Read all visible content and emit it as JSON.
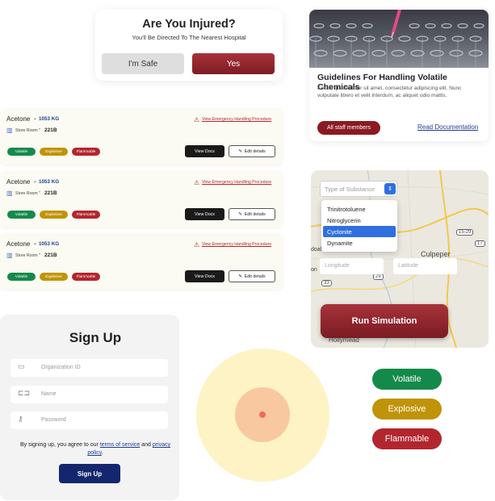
{
  "injury_dialog": {
    "title": "Are You Injured?",
    "subtitle": "You'll Be Directed To The Nearest Hospital",
    "safe_label": "I'm Safe",
    "yes_label": "Yes"
  },
  "guidelines": {
    "title": "Guidelines For Handling Volatile Chemicals",
    "body": "Korem ipsum dolor sit amet, consectetur adipiscing elit. Nunc vulputate libero et velit interdum, ac aliquet odio mattis.",
    "audience": "All staff members",
    "link": "Read Documentation"
  },
  "chemicals": [
    {
      "name": "Acetone",
      "sep": "•",
      "qty": "1053 KG",
      "store": "Store Room",
      "store_sep": "•",
      "room": "221B",
      "procedure": "View Emergency Handling Procedure",
      "tags": [
        "Volatile",
        "Explosive",
        "Flammable"
      ],
      "view": "View Docs",
      "edit": "Edit details"
    },
    {
      "name": "Acetone",
      "sep": "•",
      "qty": "1053 KG",
      "store": "Store Room",
      "store_sep": "•",
      "room": "221B",
      "procedure": "View Emergency Handling Procedure",
      "tags": [
        "Volatile",
        "Explosive",
        "Flammable"
      ],
      "view": "View Docs",
      "edit": "Edit details"
    },
    {
      "name": "Acetone",
      "sep": "•",
      "qty": "1053 KG",
      "store": "Store Room",
      "store_sep": "•",
      "room": "221B",
      "procedure": "View Emergency Handling Procedure",
      "tags": [
        "Volatile",
        "Explosive",
        "Flammable"
      ],
      "view": "View Docs",
      "edit": "Edit details"
    }
  ],
  "simulation": {
    "select_placeholder": "Type of Substance",
    "options": [
      "Trinitrotoluene",
      "Nitroglycerin",
      "Cyclonite",
      "Dynamite"
    ],
    "selected": "Cyclonite",
    "longitude_placeholder": "Longitude",
    "latitude_placeholder": "Latitude",
    "run_label": "Run Simulation",
    "map_labels": {
      "town1": "Culpeper",
      "town2": "Hollymead",
      "road1": "15-29",
      "road2": "17",
      "road3": "29",
      "road4": "33",
      "frag1": "doah",
      "frag2": "on"
    }
  },
  "signup": {
    "title": "Sign Up",
    "org_placeholder": "Organization ID",
    "name_placeholder": "Name",
    "password_placeholder": "Password",
    "terms_prefix": "By signing up, you agree to our ",
    "terms_link": "terms of service",
    "terms_and": " and ",
    "privacy_link": "privacy policy",
    "terms_suffix": ".",
    "button": "Sign Up"
  },
  "hazard_tags": [
    "Volatile",
    "Explosive",
    "Flammable"
  ],
  "colors": {
    "primary_red": "#8b1a22",
    "navy": "#14276e",
    "green": "#148a4a",
    "gold": "#c09408",
    "red": "#b3262e"
  }
}
